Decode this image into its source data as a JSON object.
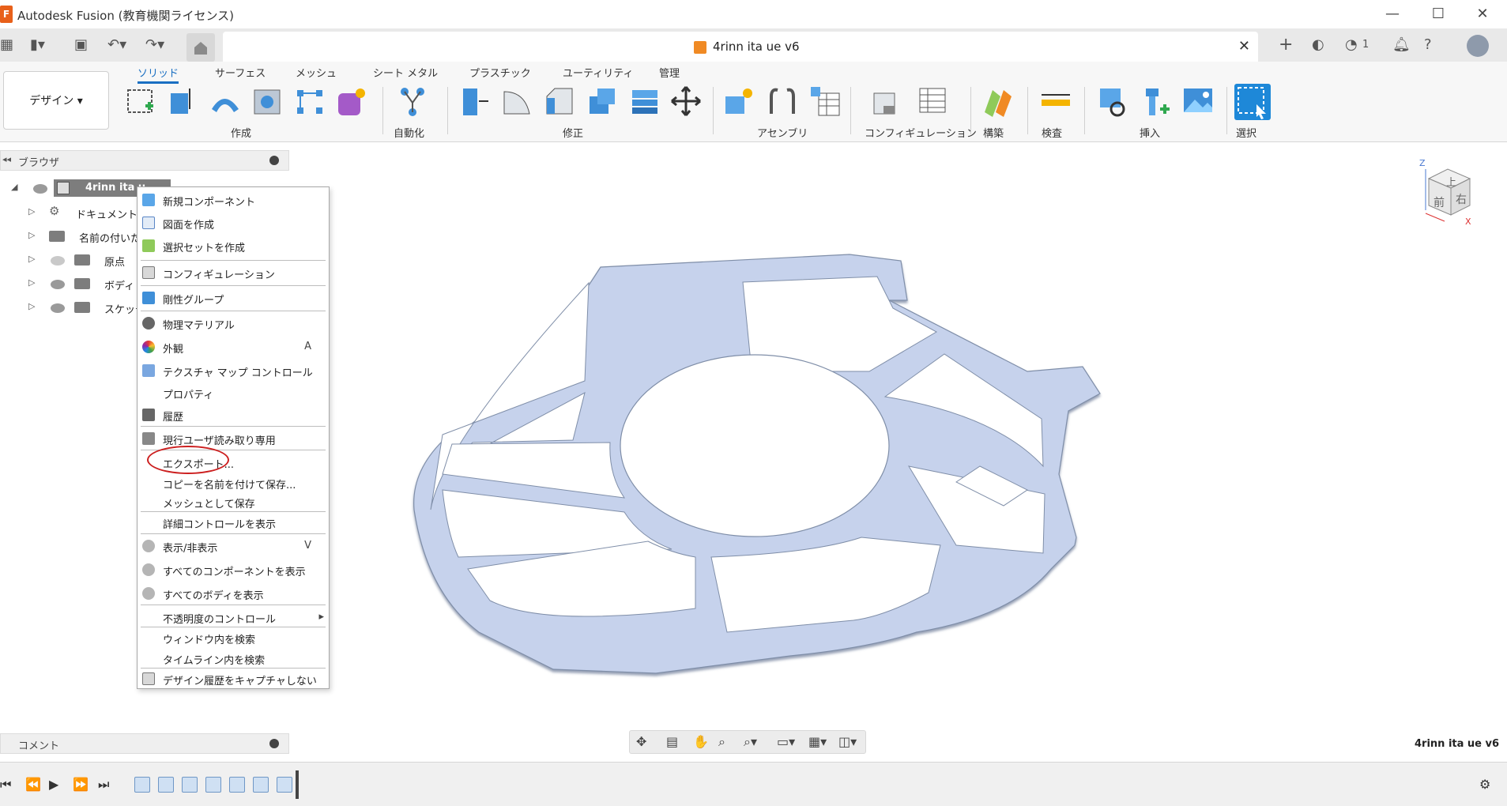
{
  "window": {
    "title": "Autodesk Fusion (教育機関ライセンス)",
    "app_icon_letter": "F",
    "controls": [
      "minimize-icon",
      "maximize-icon",
      "close-icon"
    ]
  },
  "tabbar": {
    "document_tab": "4rinn ita ue v6",
    "notification_count": "1",
    "icons": [
      "grid-icon",
      "file-icon",
      "save-icon",
      "undo-icon",
      "redo-icon",
      "home-icon",
      "plus-icon",
      "extensions-icon",
      "job-status-icon",
      "bell-icon",
      "help-icon",
      "avatar"
    ]
  },
  "toolbar": {
    "workspace": "デザイン",
    "tabs": [
      "ソリッド",
      "サーフェス",
      "メッシュ",
      "シート メタル",
      "プラスチック",
      "ユーティリティ",
      "管理"
    ],
    "active_tab": "ソリッド",
    "groups": [
      "作成",
      "自動化",
      "修正",
      "アセンブリ",
      "コンフィギュレーション",
      "構築",
      "検査",
      "挿入",
      "選択"
    ]
  },
  "browser": {
    "title": "ブラウザ",
    "root_label": "4rinn ita u",
    "items": [
      "ドキュメントの設",
      "名前の付いた",
      "原点",
      "ボディ",
      "スケッチ"
    ]
  },
  "context_menu": {
    "items": [
      {
        "label": "新規コンポーネント",
        "shortcut": ""
      },
      {
        "label": "図面を作成",
        "shortcut": ""
      },
      {
        "label": "選択セットを作成",
        "shortcut": ""
      },
      {
        "label": "コンフィギュレーション",
        "shortcut": ""
      },
      {
        "label": "剛性グループ",
        "shortcut": ""
      },
      {
        "label": "物理マテリアル",
        "shortcut": ""
      },
      {
        "label": "外観",
        "shortcut": "A"
      },
      {
        "label": "テクスチャ マップ コントロール",
        "shortcut": ""
      },
      {
        "label": "プロパティ",
        "shortcut": ""
      },
      {
        "label": "履歴",
        "shortcut": ""
      },
      {
        "label": "現行ユーザ読み取り専用",
        "shortcut": ""
      },
      {
        "label": "エクスポート...",
        "shortcut": ""
      },
      {
        "label": "コピーを名前を付けて保存...",
        "shortcut": ""
      },
      {
        "label": "メッシュとして保存",
        "shortcut": ""
      },
      {
        "label": "詳細コントロールを表示",
        "shortcut": ""
      },
      {
        "label": "表示/非表示",
        "shortcut": "V"
      },
      {
        "label": "すべてのコンポーネントを表示",
        "shortcut": ""
      },
      {
        "label": "すべてのボディを表示",
        "shortcut": ""
      },
      {
        "label": "不透明度のコントロール",
        "shortcut": "▸"
      },
      {
        "label": "ウィンドウ内を検索",
        "shortcut": ""
      },
      {
        "label": "タイムライン内を検索",
        "shortcut": ""
      },
      {
        "label": "デザイン履歴をキャプチャしない",
        "shortcut": ""
      }
    ]
  },
  "viewcube": {
    "top": "上",
    "front": "前",
    "right": "右",
    "axis_z": "Z",
    "axis_x": "X"
  },
  "comment_bar": {
    "title": "コメント"
  },
  "document_name": "4rinn ita ue v6",
  "colors": {
    "accent": "#1a6fc2",
    "part": "#c6d2ec",
    "highlight": "#cc1f1f",
    "select_tool": "#1e88d8"
  }
}
